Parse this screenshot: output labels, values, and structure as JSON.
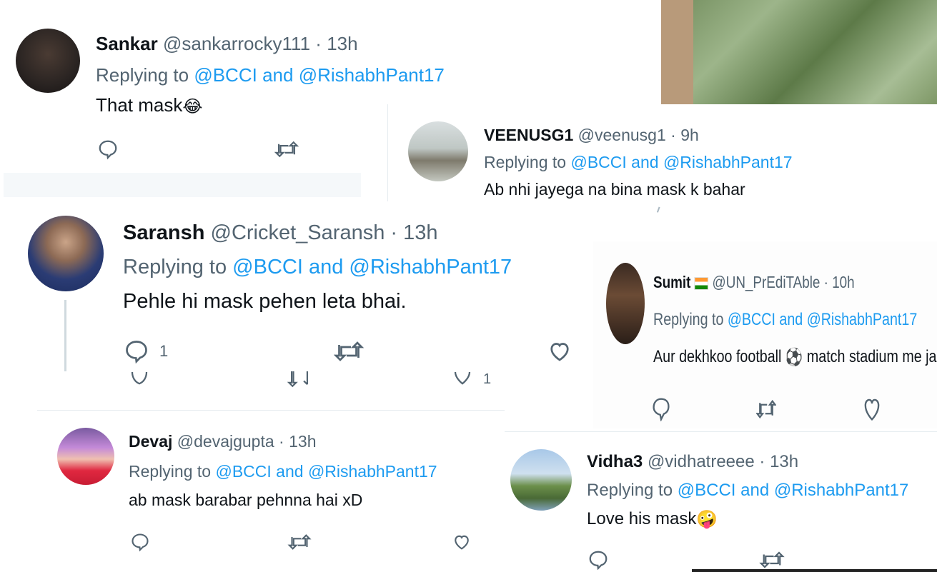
{
  "tweets": [
    {
      "name": "Sankar",
      "handle": "@sankarrocky111",
      "sep": "·",
      "time": "13h",
      "replying_prefix": "Replying to",
      "mention1": "@BCCI",
      "and": "and",
      "mention2": "@RishabhPant17",
      "text": "That mask",
      "emoji": "😂"
    },
    {
      "name": "VEENUSG1",
      "handle": "@veenusg1",
      "sep": "·",
      "time": "9h",
      "replying_prefix": "Replying to",
      "mention1": "@BCCI",
      "and": "and",
      "mention2": "@RishabhPant17",
      "text": "Ab nhi jayega na bina mask k bahar"
    },
    {
      "name": "Saransh",
      "handle": "@Cricket_Saransh",
      "sep": "·",
      "time": "13h",
      "replying_prefix": "Replying to",
      "mention1": "@BCCI",
      "and": "and",
      "mention2": "@RishabhPant17",
      "text": "Pehle hi mask pehen leta bhai.",
      "reply_count": "1",
      "like_count_below": "1"
    },
    {
      "name": "Sumit",
      "flag": "India flag",
      "handle": "@UN_PrEdiTAble",
      "sep": "·",
      "time": "10h",
      "replying_prefix": "Replying to",
      "mention1": "@BCCI",
      "and": "and",
      "mention2": "@RishabhPant17",
      "text_part1": "Aur dekhkoo football",
      "emoji1": "⚽",
      "text_part2": "match stadium me jaake",
      "emoji2": "🙄"
    },
    {
      "name": "Devaj",
      "handle": "@devajgupta",
      "sep": "·",
      "time": "13h",
      "replying_prefix": "Replying to",
      "mention1": "@BCCI",
      "and": "and",
      "mention2": "@RishabhPant17",
      "text": "ab mask barabar pehnna hai xD"
    },
    {
      "name": "Vidha3",
      "handle": "@vidhatreeee",
      "sep": "·",
      "time": "13h",
      "replying_prefix": "Replying to",
      "mention1": "@BCCI",
      "and": "and",
      "mention2": "@RishabhPant17",
      "text": "Love his mask",
      "emoji": "🤪"
    }
  ],
  "icons": {
    "reply": "reply-icon",
    "retweet": "retweet-icon",
    "like": "heart-icon"
  },
  "colors": {
    "link": "#1d9bf0",
    "secondary": "#536471",
    "text": "#0f1419"
  }
}
